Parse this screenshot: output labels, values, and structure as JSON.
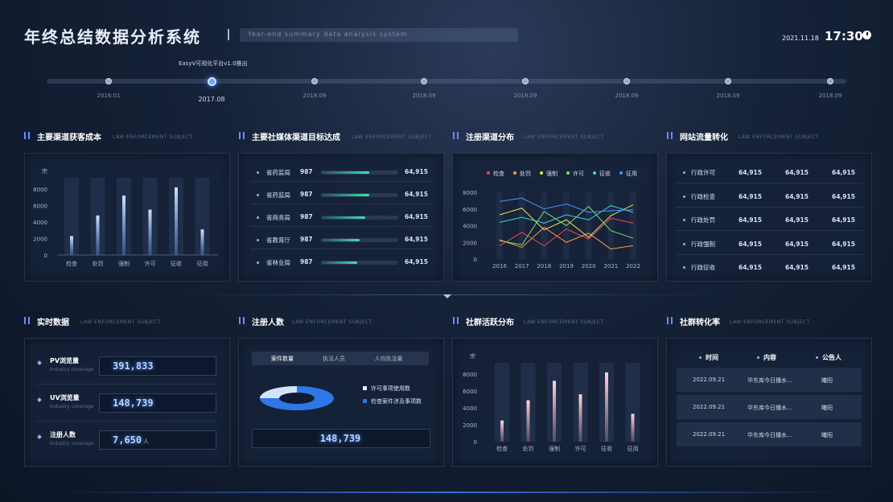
{
  "header": {
    "title": "年终总结数据分析系统",
    "subtitle": "Year-end summary data analysis system",
    "date": "2021.11.18",
    "time": "17:30"
  },
  "timeline": {
    "note": "EasyV可视化平台v1.0推出",
    "points": [
      {
        "label": "2016.01",
        "active": false
      },
      {
        "label": "2017.08",
        "active": true
      },
      {
        "label": "2018.09",
        "active": false
      },
      {
        "label": "2018.09",
        "active": false
      },
      {
        "label": "2018.09",
        "active": false
      },
      {
        "label": "2018.09",
        "active": false
      },
      {
        "label": "2018.09",
        "active": false
      },
      {
        "label": "2018.09",
        "active": false
      }
    ]
  },
  "sections": {
    "en_label": "LAW ENFORCEMENT SUBJECT",
    "s1": "主要渠道获客成本",
    "s2": "主要社媒体渠道目标达成",
    "s3": "注册渠道分布",
    "s4": "网站流量转化",
    "s5": "实时数据",
    "s6": "注册人数",
    "s7": "社群活跃分布",
    "s8": "社群转化率"
  },
  "acquisition_cost": {
    "y_unit": "宗",
    "y_ticks": [
      "8000",
      "6000",
      "4000",
      "2000",
      "0"
    ]
  },
  "social_targets": {
    "rows": [
      {
        "name": "省药监局",
        "count": "987",
        "value": "64,915",
        "progress": 0.63
      },
      {
        "name": "省药监局",
        "count": "987",
        "value": "64,915",
        "progress": 0.63
      },
      {
        "name": "省商务局",
        "count": "987",
        "value": "64,915",
        "progress": 0.57
      },
      {
        "name": "省教育厅",
        "count": "987",
        "value": "64,915",
        "progress": 0.5
      },
      {
        "name": "省林业局",
        "count": "987",
        "value": "64,915",
        "progress": 0.47
      }
    ]
  },
  "traffic": {
    "rows": [
      {
        "name": "行政许可",
        "v1": "64,915",
        "v2": "64,915",
        "v3": "64,915"
      },
      {
        "name": "行政检查",
        "v1": "64,915",
        "v2": "64,915",
        "v3": "64,915"
      },
      {
        "name": "行政处罚",
        "v1": "64,915",
        "v2": "64,915",
        "v3": "64,915"
      },
      {
        "name": "行政强制",
        "v1": "64,915",
        "v2": "64,915",
        "v3": "64,915"
      },
      {
        "name": "行政征收",
        "v1": "64,915",
        "v2": "64,915",
        "v3": "64,915"
      }
    ]
  },
  "realtime": {
    "rows": [
      {
        "label": "PV浏览量",
        "sub": "Industry coverage",
        "value": "391,833",
        "unit": ""
      },
      {
        "label": "UV浏览量",
        "sub": "Industry coverage",
        "value": "148,739",
        "unit": ""
      },
      {
        "label": "注册人数",
        "sub": "Industry coverage",
        "value": "7,650",
        "unit": "人"
      }
    ]
  },
  "registrations": {
    "tabs": [
      "案件数量",
      "执法人员",
      "人均执法量"
    ],
    "legend": [
      "许可事项使用数",
      "检查案件涉及事项数"
    ],
    "total": "148,739"
  },
  "conversion": {
    "headers": [
      "时间",
      "内容",
      "公告人"
    ],
    "rows": [
      {
        "time": "2022.09.21",
        "content": "华东库今日播水…",
        "person": "曦阳"
      },
      {
        "time": "2022.09.21",
        "content": "华东库今日播水…",
        "person": "曦阳"
      },
      {
        "time": "2022.09.21",
        "content": "华东库今日播水…",
        "person": "曦阳"
      }
    ]
  },
  "chart_data": [
    {
      "type": "bar",
      "categories": [
        "检查",
        "处罚",
        "强制",
        "许可",
        "征收",
        "征用"
      ],
      "values": [
        2300,
        4800,
        7200,
        5500,
        8200,
        3100
      ],
      "ylabel": "宗",
      "ylim": [
        0,
        8000
      ],
      "color": "#6fa6ff"
    },
    {
      "type": "line",
      "x": [
        "2016",
        "2017",
        "2018",
        "2019",
        "2020",
        "2021",
        "2022"
      ],
      "ylim": [
        0,
        8000
      ],
      "y_ticks": [
        "8000",
        "6000",
        "4000",
        "2000",
        "0"
      ],
      "series": [
        {
          "name": "检查",
          "color": "#f0455a",
          "values": [
            1600,
            3200,
            1600,
            3600,
            2400,
            4900,
            4300
          ]
        },
        {
          "name": "处罚",
          "color": "#ff9a3c",
          "values": [
            2300,
            1400,
            3800,
            2000,
            3100,
            1200,
            1600
          ]
        },
        {
          "name": "强制",
          "color": "#e7e356",
          "values": [
            5300,
            6100,
            3500,
            4700,
            2600,
            5200,
            6500
          ]
        },
        {
          "name": "许可",
          "color": "#7be06a",
          "values": [
            2200,
            1700,
            5700,
            4000,
            6300,
            3400,
            2500
          ]
        },
        {
          "name": "征收",
          "color": "#3fd6d6",
          "values": [
            4400,
            5000,
            4300,
            5300,
            4700,
            6400,
            5600
          ]
        },
        {
          "name": "征用",
          "color": "#4d94ff",
          "values": [
            6900,
            7300,
            6000,
            6600,
            5600,
            5800,
            5900
          ]
        }
      ]
    },
    {
      "type": "pie",
      "labels": [
        "许可事项使用数",
        "检查案件涉及事项数"
      ],
      "values": [
        22,
        78
      ],
      "colors": [
        "#e8f1ff",
        "#2f76e6"
      ]
    },
    {
      "type": "bar",
      "categories": [
        "检查",
        "处罚",
        "强制",
        "许可",
        "征收",
        "征用"
      ],
      "values": [
        2500,
        4900,
        7200,
        5600,
        8200,
        3300
      ],
      "ylabel": "宗",
      "ylim": [
        0,
        8000
      ],
      "y_ticks": [
        "8000",
        "6000",
        "4000",
        "2000",
        "0"
      ],
      "color": "#f3a7b0"
    }
  ]
}
